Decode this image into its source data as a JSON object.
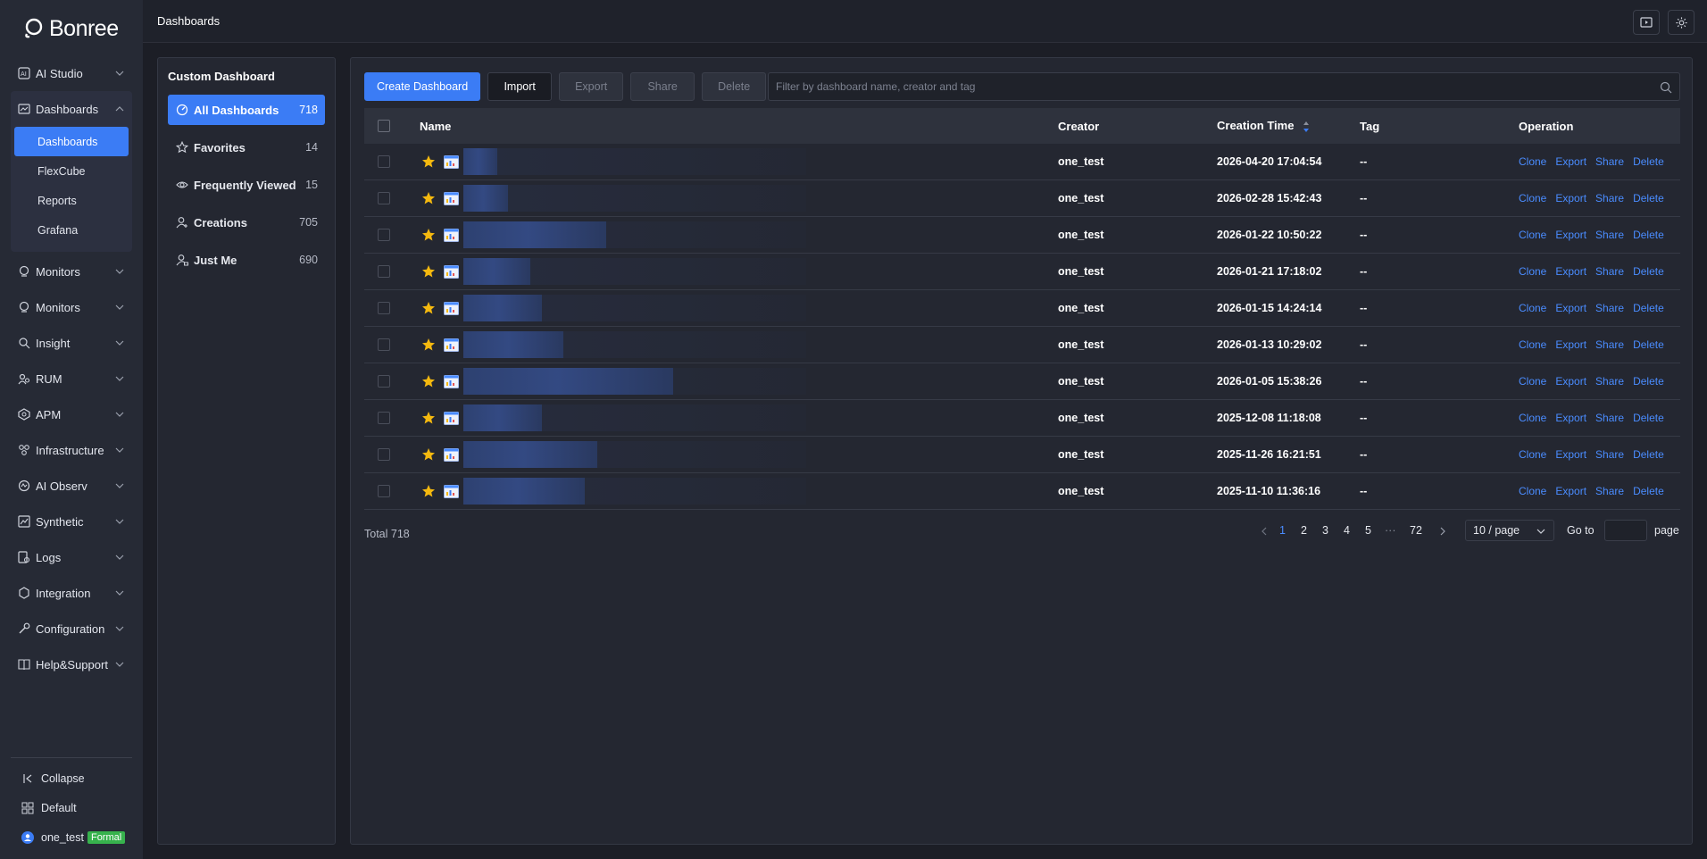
{
  "brand": {
    "name": "Bonree"
  },
  "nav": {
    "items_top": [
      {
        "label": "AI Studio",
        "icon": "ai-studio-icon"
      }
    ],
    "dashboards_group": {
      "label": "Dashboards",
      "sub_items": [
        "Dashboards",
        "FlexCube",
        "Reports",
        "Grafana"
      ]
    },
    "items": [
      {
        "label": "Monitors",
        "icon": "monitor-icon"
      },
      {
        "label": "Monitors",
        "icon": "monitor-icon"
      },
      {
        "label": "Insight",
        "icon": "insight-icon"
      },
      {
        "label": "RUM",
        "icon": "rum-icon"
      },
      {
        "label": "APM",
        "icon": "apm-icon"
      },
      {
        "label": "Infrastructure",
        "icon": "infrastructure-icon"
      },
      {
        "label": "AI Observ",
        "icon": "ai-observ-icon"
      },
      {
        "label": "Synthetic",
        "icon": "synthetic-icon"
      },
      {
        "label": "Logs",
        "icon": "logs-icon"
      },
      {
        "label": "Integration",
        "icon": "integration-icon"
      },
      {
        "label": "Configuration",
        "icon": "configuration-icon"
      },
      {
        "label": "Help&Support",
        "icon": "help-icon"
      }
    ],
    "bottom": {
      "collapse": "Collapse",
      "workspace": "Default",
      "user": "one_test",
      "user_badge": "Formal"
    }
  },
  "topbar": {
    "title": "Dashboards"
  },
  "panel": {
    "title": "Custom Dashboard",
    "categories": [
      {
        "label": "All Dashboards",
        "count": "718",
        "icon": "dashboard-gauge-icon",
        "active": true
      },
      {
        "label": "Favorites",
        "count": "14",
        "icon": "star-outline-icon"
      },
      {
        "label": "Frequently Viewed",
        "count": "15",
        "icon": "eye-icon"
      },
      {
        "label": "Creations",
        "count": "705",
        "icon": "user-add-icon"
      },
      {
        "label": "Just Me",
        "count": "690",
        "icon": "user-lock-icon"
      }
    ]
  },
  "toolbar": {
    "create": "Create Dashboard",
    "import": "Import",
    "export": "Export",
    "share": "Share",
    "delete": "Delete",
    "search_placeholder": "Filter by dashboard name, creator and tag"
  },
  "table": {
    "headers": {
      "name": "Name",
      "creator": "Creator",
      "time": "Creation Time",
      "tag": "Tag",
      "operation": "Operation"
    },
    "op_labels": {
      "clone": "Clone",
      "export": "Export",
      "share": "Share",
      "delete": "Delete"
    },
    "rows": [
      {
        "creator": "one_test",
        "time": "2026-04-20 17:04:54",
        "tag": "--"
      },
      {
        "creator": "one_test",
        "time": "2026-02-28 15:42:43",
        "tag": "--"
      },
      {
        "creator": "one_test",
        "time": "2026-01-22 10:50:22",
        "tag": "--"
      },
      {
        "creator": "one_test",
        "time": "2026-01-21 17:18:02",
        "tag": "--"
      },
      {
        "creator": "one_test",
        "time": "2026-01-15 14:24:14",
        "tag": "--"
      },
      {
        "creator": "one_test",
        "time": "2026-01-13 10:29:02",
        "tag": "--"
      },
      {
        "creator": "one_test",
        "time": "2026-01-05 15:38:26",
        "tag": "--"
      },
      {
        "creator": "one_test",
        "time": "2025-12-08 11:18:08",
        "tag": "--"
      },
      {
        "creator": "one_test",
        "time": "2025-11-26 16:21:51",
        "tag": "--"
      },
      {
        "creator": "one_test",
        "time": "2025-11-10 11:36:16",
        "tag": "--"
      }
    ]
  },
  "pagination": {
    "total": "Total 718",
    "pages": [
      "1",
      "2",
      "3",
      "4",
      "5"
    ],
    "ellipsis": "···",
    "last": "72",
    "page_size": "10 / page",
    "goto": "Go to",
    "page_suffix": "page"
  },
  "colors": {
    "accent": "#3b7cf5",
    "link": "#4a8cff",
    "star": "#f5b90f"
  }
}
